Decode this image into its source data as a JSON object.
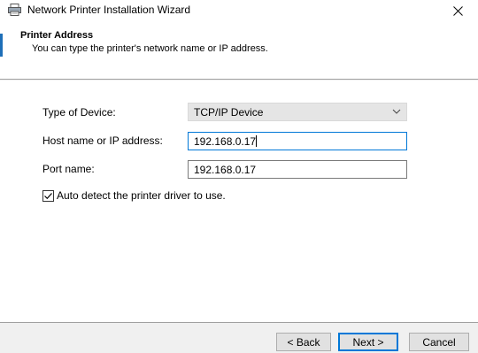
{
  "window": {
    "title": "Network Printer Installation Wizard"
  },
  "header": {
    "title": "Printer Address",
    "subtitle": "You can type the printer's network name or IP address."
  },
  "form": {
    "device_type_label": "Type of Device:",
    "device_type_value": "TCP/IP Device",
    "host_label": "Host name or IP address:",
    "host_value": "192.168.0.17",
    "port_label": "Port name:",
    "port_value": "192.168.0.17",
    "auto_detect_label": "Auto detect the printer driver to use.",
    "auto_detect_checked": true
  },
  "buttons": {
    "back": "< Back",
    "next": "Next >",
    "cancel": "Cancel"
  },
  "icons": {
    "title": "printer-icon",
    "close": "close-icon",
    "dropdown": "chevron-down-icon",
    "check": "checkmark-icon"
  },
  "colors": {
    "accent": "#0078d7",
    "strip": "#1e6fb8"
  }
}
